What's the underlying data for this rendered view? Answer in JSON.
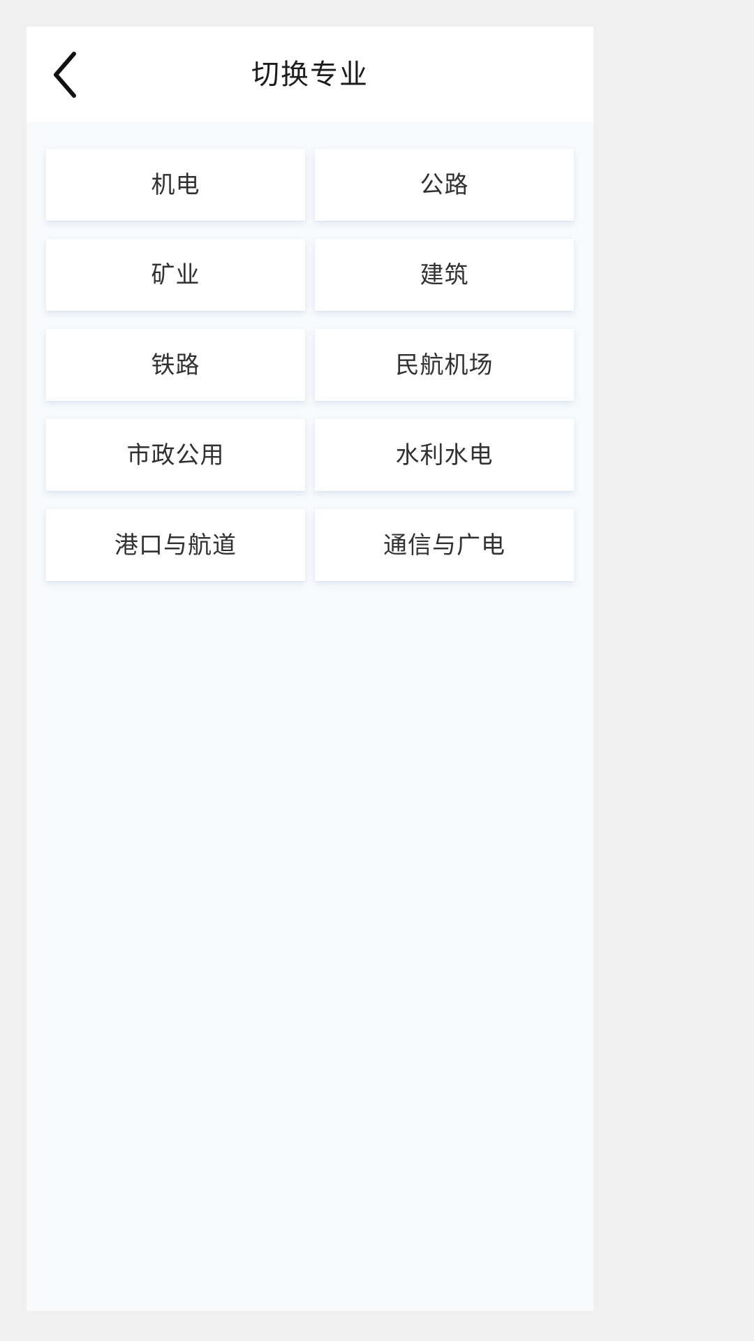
{
  "header": {
    "title": "切换专业",
    "back_icon": "chevron-left-icon"
  },
  "colors": {
    "page_background": "#f0f0f0",
    "viewport_background": "#f8fafc",
    "header_background": "#ffffff",
    "card_background": "#ffffff",
    "title_text": "#1c1c1e",
    "card_text": "#303133",
    "card_shadow": "#aac4e1"
  },
  "specialty_grid": {
    "columns": 2,
    "items": [
      {
        "label": "机电"
      },
      {
        "label": "公路"
      },
      {
        "label": "矿业"
      },
      {
        "label": "建筑"
      },
      {
        "label": "铁路"
      },
      {
        "label": "民航机场"
      },
      {
        "label": "市政公用"
      },
      {
        "label": "水利水电"
      },
      {
        "label": "港口与航道"
      },
      {
        "label": "通信与广电"
      }
    ]
  }
}
